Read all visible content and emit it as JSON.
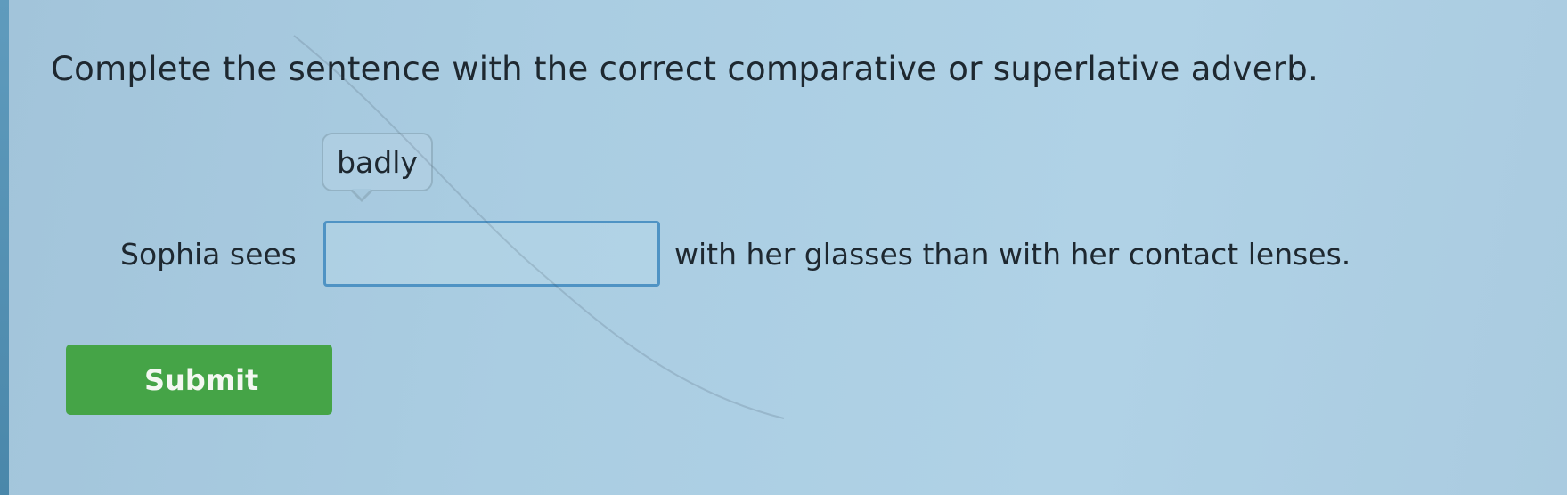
{
  "question": {
    "instruction": "Complete the sentence with the correct comparative or superlative adverb.",
    "base_word": "badly",
    "sentence_before": "Sophia sees",
    "answer_value": "",
    "sentence_after": "with her glasses than with her contact lenses."
  },
  "actions": {
    "submit_label": "Submit"
  },
  "colors": {
    "background": "#a9cbe0",
    "submit_button": "#45a447",
    "input_border": "#4f93c4"
  }
}
